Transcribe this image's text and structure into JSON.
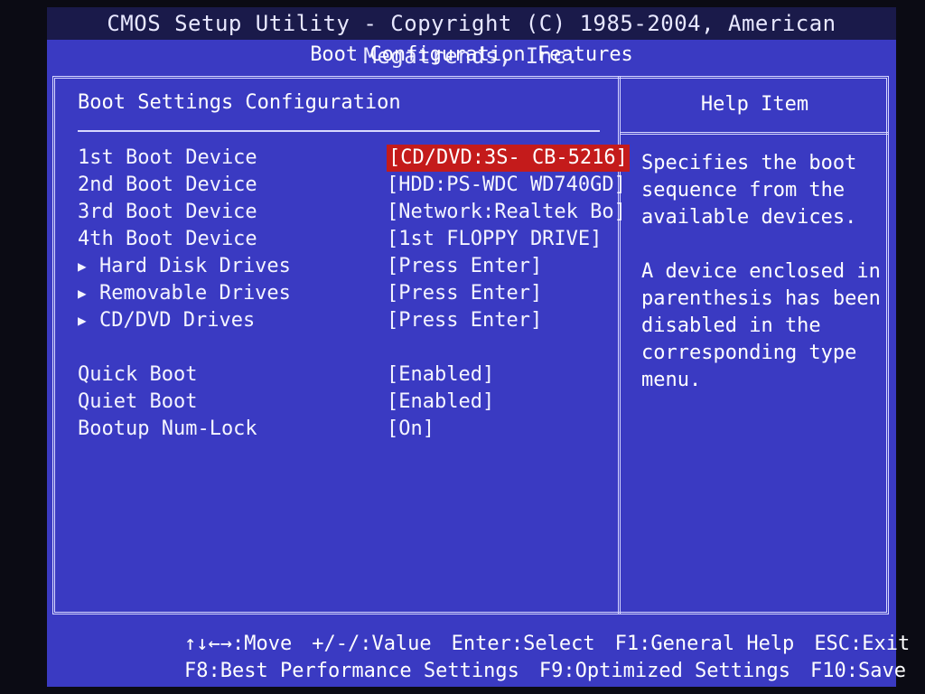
{
  "header": {
    "title": "CMOS Setup Utility - Copyright (C) 1985-2004, American Megatrends, Inc.",
    "subtitle": "Boot Configuration Features"
  },
  "main": {
    "section_title": "Boot Settings Configuration",
    "items": [
      {
        "label": "1st Boot Device",
        "value": "[CD/DVD:3S- CB-5216]"
      },
      {
        "label": "2nd Boot Device",
        "value": "[HDD:PS-WDC WD740GD]"
      },
      {
        "label": "3rd Boot Device",
        "value": "[Network:Realtek Bo]"
      },
      {
        "label": "4th Boot Device",
        "value": "[1st FLOPPY DRIVE]"
      },
      {
        "label": "Hard Disk Drives",
        "value": "[Press Enter]"
      },
      {
        "label": "Removable Drives",
        "value": "[Press Enter]"
      },
      {
        "label": "CD/DVD Drives",
        "value": "[Press Enter]"
      },
      {
        "label": "Quick Boot",
        "value": "[Enabled]"
      },
      {
        "label": "Quiet Boot",
        "value": "[Enabled]"
      },
      {
        "label": "Bootup Num-Lock",
        "value": "[On]"
      }
    ],
    "submenu_arrow": "▶"
  },
  "help": {
    "title": "Help Item",
    "paragraph1": "Specifies the boot sequence from the available devices.",
    "paragraph2": "A device enclosed in parenthesis has been disabled in the corresponding type menu."
  },
  "footer": {
    "line1": [
      "↑↓←→:Move",
      "+/-/:Value",
      "Enter:Select",
      "F1:General Help",
      "ESC:Exit"
    ],
    "line2": [
      "F8:Best Performance Settings",
      "F9:Optimized Settings",
      "F10:Save"
    ]
  },
  "colors": {
    "background": "#3a3ac2",
    "title_bar": "#1a1a4a",
    "highlight": "#c41b1b",
    "text": "#ffffff"
  }
}
